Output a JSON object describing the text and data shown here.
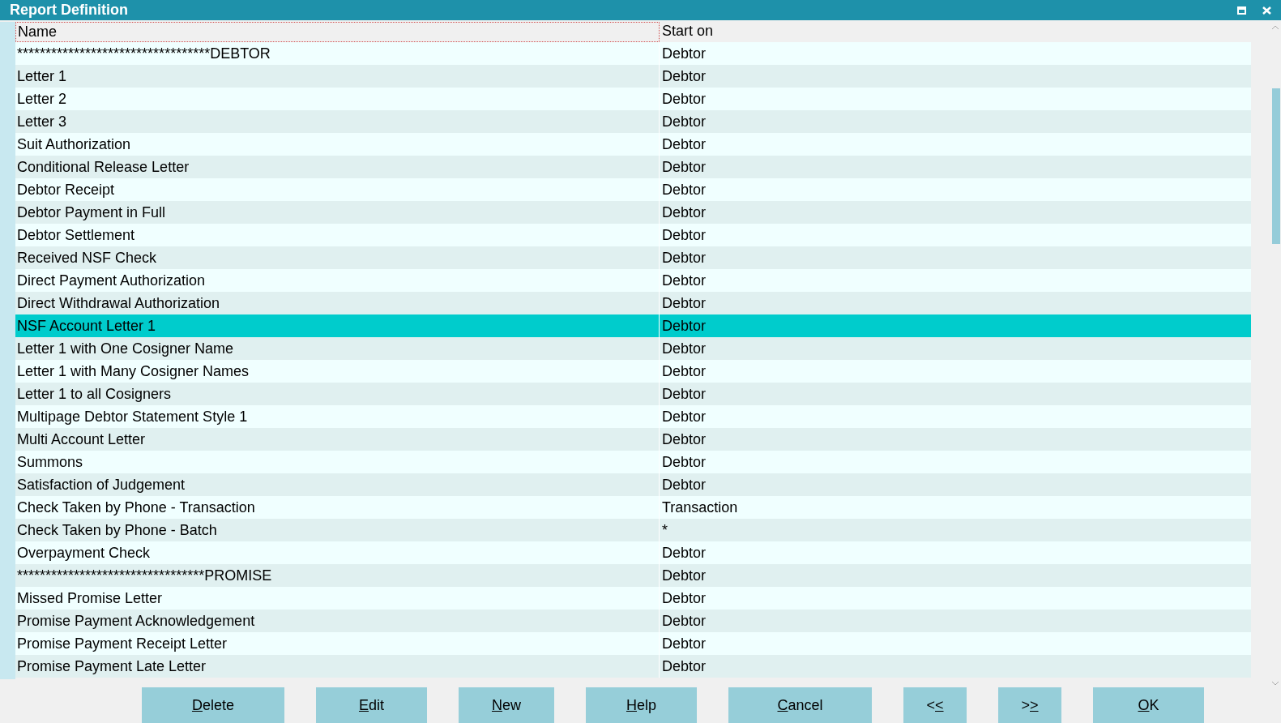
{
  "window": {
    "title": "Report Definition"
  },
  "table": {
    "columns": [
      "Name",
      "Start on"
    ],
    "rows": [
      {
        "name": "**********************************DEBTOR",
        "start_on": "Debtor",
        "selected": false
      },
      {
        "name": "Letter 1",
        "start_on": "Debtor",
        "selected": false
      },
      {
        "name": "Letter 2",
        "start_on": "Debtor",
        "selected": false
      },
      {
        "name": "Letter 3",
        "start_on": "Debtor",
        "selected": false
      },
      {
        "name": "Suit Authorization",
        "start_on": "Debtor",
        "selected": false
      },
      {
        "name": "Conditional Release Letter",
        "start_on": "Debtor",
        "selected": false
      },
      {
        "name": "Debtor Receipt",
        "start_on": "Debtor",
        "selected": false
      },
      {
        "name": "Debtor Payment in Full",
        "start_on": "Debtor",
        "selected": false
      },
      {
        "name": "Debtor Settlement",
        "start_on": "Debtor",
        "selected": false
      },
      {
        "name": "Received NSF Check",
        "start_on": "Debtor",
        "selected": false
      },
      {
        "name": "Direct Payment Authorization",
        "start_on": "Debtor",
        "selected": false
      },
      {
        "name": "Direct Withdrawal Authorization",
        "start_on": "Debtor",
        "selected": false
      },
      {
        "name": "NSF Account Letter 1",
        "start_on": "Debtor",
        "selected": true
      },
      {
        "name": "Letter 1 with One Cosigner Name",
        "start_on": "Debtor",
        "selected": false
      },
      {
        "name": "Letter 1 with Many Cosigner Names",
        "start_on": "Debtor",
        "selected": false
      },
      {
        "name": "Letter 1 to all Cosigners",
        "start_on": "Debtor",
        "selected": false
      },
      {
        "name": "Multipage Debtor Statement Style 1",
        "start_on": "Debtor",
        "selected": false
      },
      {
        "name": "Multi Account Letter",
        "start_on": "Debtor",
        "selected": false
      },
      {
        "name": "Summons",
        "start_on": "Debtor",
        "selected": false
      },
      {
        "name": "Satisfaction of Judgement",
        "start_on": "Debtor",
        "selected": false
      },
      {
        "name": "Check Taken by Phone - Transaction",
        "start_on": "Transaction",
        "selected": false
      },
      {
        "name": "Check Taken by Phone - Batch",
        "start_on": "*",
        "selected": false
      },
      {
        "name": "Overpayment Check",
        "start_on": "Debtor",
        "selected": false
      },
      {
        "name": "*********************************PROMISE",
        "start_on": "Debtor",
        "selected": false
      },
      {
        "name": "Missed Promise Letter",
        "start_on": "Debtor",
        "selected": false
      },
      {
        "name": "Promise Payment Acknowledgement",
        "start_on": "Debtor",
        "selected": false
      },
      {
        "name": "Promise Payment Receipt Letter",
        "start_on": "Debtor",
        "selected": false
      },
      {
        "name": "Promise Payment Late Letter",
        "start_on": "Debtor",
        "selected": false
      }
    ]
  },
  "buttons": [
    {
      "label": "Delete",
      "mnemonic_on_second_char": false
    },
    {
      "label": "Edit",
      "mnemonic_on_second_char": false
    },
    {
      "label": "New",
      "mnemonic_on_second_char": false
    },
    {
      "label": "Help",
      "mnemonic_on_second_char": false
    },
    {
      "label": "Cancel",
      "mnemonic_on_second_char": false
    },
    {
      "label": "<<",
      "mnemonic_on_second_char": true
    },
    {
      "label": ">>",
      "mnemonic_on_second_char": true
    },
    {
      "label": "OK",
      "mnemonic_on_second_char": false
    }
  ]
}
